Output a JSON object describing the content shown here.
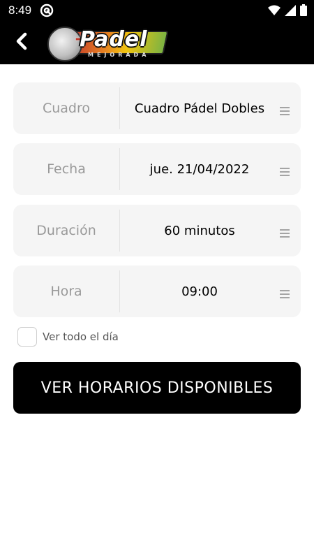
{
  "status_bar": {
    "time": "8:49",
    "icons": [
      "wifi-icon",
      "signal-icon",
      "battery-icon"
    ]
  },
  "app_bar": {
    "back_icon": "chevron-left-icon",
    "logo_text": "Padel",
    "logo_subtitle": "MEJORADA"
  },
  "form": {
    "rows": [
      {
        "label": "Cuadro",
        "value": "Cuadro Pádel Dobles"
      },
      {
        "label": "Fecha",
        "value": "jue. 21/04/2022"
      },
      {
        "label": "Duración",
        "value": "60 minutos"
      },
      {
        "label": "Hora",
        "value": "09:00"
      }
    ],
    "checkbox_label": "Ver todo el día",
    "submit_label": "VER HORARIOS DISPONIBLES"
  }
}
